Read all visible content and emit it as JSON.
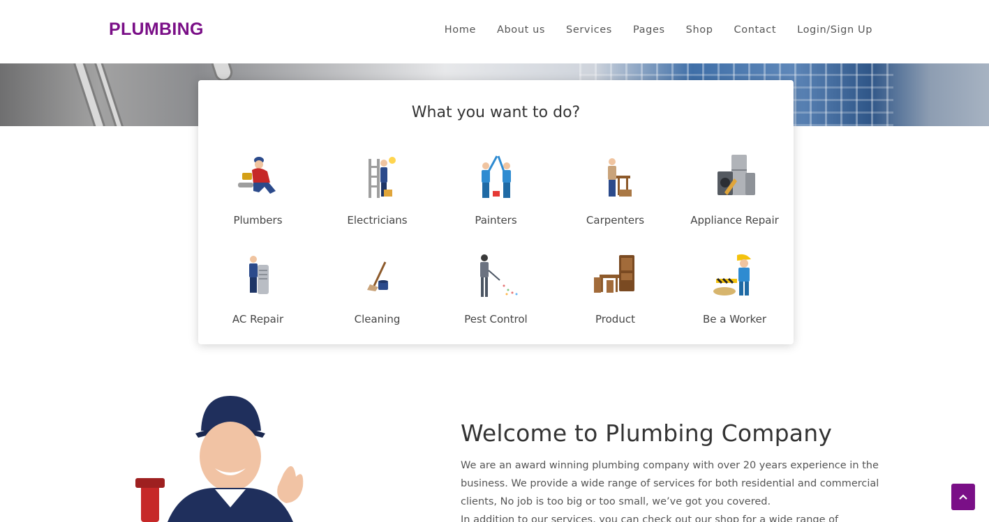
{
  "brand": {
    "logo": "PLUMBING",
    "accent": "#7a0f87"
  },
  "nav": [
    {
      "label": "Home"
    },
    {
      "label": "About us"
    },
    {
      "label": "Services"
    },
    {
      "label": "Pages"
    },
    {
      "label": "Shop"
    },
    {
      "label": "Contact"
    },
    {
      "label": "Login/Sign Up"
    }
  ],
  "services_card": {
    "title": "What you want to do?",
    "items": [
      {
        "label": "Plumbers",
        "icon": "plumber-icon"
      },
      {
        "label": "Electricians",
        "icon": "electrician-icon"
      },
      {
        "label": "Painters",
        "icon": "painters-icon"
      },
      {
        "label": "Carpenters",
        "icon": "carpenter-icon"
      },
      {
        "label": "Appliance Repair",
        "icon": "appliance-icon"
      },
      {
        "label": "AC Repair",
        "icon": "ac-repair-icon"
      },
      {
        "label": "Cleaning",
        "icon": "cleaning-icon"
      },
      {
        "label": "Pest Control",
        "icon": "pest-control-icon"
      },
      {
        "label": "Product",
        "icon": "furniture-icon"
      },
      {
        "label": "Be a Worker",
        "icon": "construction-worker-icon"
      }
    ]
  },
  "welcome": {
    "title": "Welcome to Plumbing Company",
    "paragraph1": "We are an award winning plumbing company with over 20 years experience in the business. We provide a wide range of services for both residential and commercial clients, No job is too big or too small, we’ve got you covered.",
    "paragraph2": "In addition to our services, you can check out our shop for a wide range of plumbing"
  }
}
